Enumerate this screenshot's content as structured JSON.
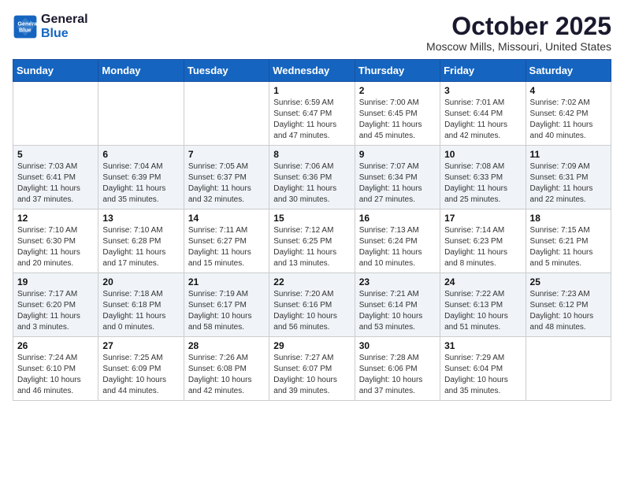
{
  "header": {
    "logo_line1": "General",
    "logo_line2": "Blue",
    "title": "October 2025",
    "subtitle": "Moscow Mills, Missouri, United States"
  },
  "weekdays": [
    "Sunday",
    "Monday",
    "Tuesday",
    "Wednesday",
    "Thursday",
    "Friday",
    "Saturday"
  ],
  "weeks": [
    {
      "shaded": false,
      "days": [
        {
          "date": "",
          "info": ""
        },
        {
          "date": "",
          "info": ""
        },
        {
          "date": "",
          "info": ""
        },
        {
          "date": "1",
          "info": "Sunrise: 6:59 AM\nSunset: 6:47 PM\nDaylight: 11 hours\nand 47 minutes."
        },
        {
          "date": "2",
          "info": "Sunrise: 7:00 AM\nSunset: 6:45 PM\nDaylight: 11 hours\nand 45 minutes."
        },
        {
          "date": "3",
          "info": "Sunrise: 7:01 AM\nSunset: 6:44 PM\nDaylight: 11 hours\nand 42 minutes."
        },
        {
          "date": "4",
          "info": "Sunrise: 7:02 AM\nSunset: 6:42 PM\nDaylight: 11 hours\nand 40 minutes."
        }
      ]
    },
    {
      "shaded": true,
      "days": [
        {
          "date": "5",
          "info": "Sunrise: 7:03 AM\nSunset: 6:41 PM\nDaylight: 11 hours\nand 37 minutes."
        },
        {
          "date": "6",
          "info": "Sunrise: 7:04 AM\nSunset: 6:39 PM\nDaylight: 11 hours\nand 35 minutes."
        },
        {
          "date": "7",
          "info": "Sunrise: 7:05 AM\nSunset: 6:37 PM\nDaylight: 11 hours\nand 32 minutes."
        },
        {
          "date": "8",
          "info": "Sunrise: 7:06 AM\nSunset: 6:36 PM\nDaylight: 11 hours\nand 30 minutes."
        },
        {
          "date": "9",
          "info": "Sunrise: 7:07 AM\nSunset: 6:34 PM\nDaylight: 11 hours\nand 27 minutes."
        },
        {
          "date": "10",
          "info": "Sunrise: 7:08 AM\nSunset: 6:33 PM\nDaylight: 11 hours\nand 25 minutes."
        },
        {
          "date": "11",
          "info": "Sunrise: 7:09 AM\nSunset: 6:31 PM\nDaylight: 11 hours\nand 22 minutes."
        }
      ]
    },
    {
      "shaded": false,
      "days": [
        {
          "date": "12",
          "info": "Sunrise: 7:10 AM\nSunset: 6:30 PM\nDaylight: 11 hours\nand 20 minutes."
        },
        {
          "date": "13",
          "info": "Sunrise: 7:10 AM\nSunset: 6:28 PM\nDaylight: 11 hours\nand 17 minutes."
        },
        {
          "date": "14",
          "info": "Sunrise: 7:11 AM\nSunset: 6:27 PM\nDaylight: 11 hours\nand 15 minutes."
        },
        {
          "date": "15",
          "info": "Sunrise: 7:12 AM\nSunset: 6:25 PM\nDaylight: 11 hours\nand 13 minutes."
        },
        {
          "date": "16",
          "info": "Sunrise: 7:13 AM\nSunset: 6:24 PM\nDaylight: 11 hours\nand 10 minutes."
        },
        {
          "date": "17",
          "info": "Sunrise: 7:14 AM\nSunset: 6:23 PM\nDaylight: 11 hours\nand 8 minutes."
        },
        {
          "date": "18",
          "info": "Sunrise: 7:15 AM\nSunset: 6:21 PM\nDaylight: 11 hours\nand 5 minutes."
        }
      ]
    },
    {
      "shaded": true,
      "days": [
        {
          "date": "19",
          "info": "Sunrise: 7:17 AM\nSunset: 6:20 PM\nDaylight: 11 hours\nand 3 minutes."
        },
        {
          "date": "20",
          "info": "Sunrise: 7:18 AM\nSunset: 6:18 PM\nDaylight: 11 hours\nand 0 minutes."
        },
        {
          "date": "21",
          "info": "Sunrise: 7:19 AM\nSunset: 6:17 PM\nDaylight: 10 hours\nand 58 minutes."
        },
        {
          "date": "22",
          "info": "Sunrise: 7:20 AM\nSunset: 6:16 PM\nDaylight: 10 hours\nand 56 minutes."
        },
        {
          "date": "23",
          "info": "Sunrise: 7:21 AM\nSunset: 6:14 PM\nDaylight: 10 hours\nand 53 minutes."
        },
        {
          "date": "24",
          "info": "Sunrise: 7:22 AM\nSunset: 6:13 PM\nDaylight: 10 hours\nand 51 minutes."
        },
        {
          "date": "25",
          "info": "Sunrise: 7:23 AM\nSunset: 6:12 PM\nDaylight: 10 hours\nand 48 minutes."
        }
      ]
    },
    {
      "shaded": false,
      "days": [
        {
          "date": "26",
          "info": "Sunrise: 7:24 AM\nSunset: 6:10 PM\nDaylight: 10 hours\nand 46 minutes."
        },
        {
          "date": "27",
          "info": "Sunrise: 7:25 AM\nSunset: 6:09 PM\nDaylight: 10 hours\nand 44 minutes."
        },
        {
          "date": "28",
          "info": "Sunrise: 7:26 AM\nSunset: 6:08 PM\nDaylight: 10 hours\nand 42 minutes."
        },
        {
          "date": "29",
          "info": "Sunrise: 7:27 AM\nSunset: 6:07 PM\nDaylight: 10 hours\nand 39 minutes."
        },
        {
          "date": "30",
          "info": "Sunrise: 7:28 AM\nSunset: 6:06 PM\nDaylight: 10 hours\nand 37 minutes."
        },
        {
          "date": "31",
          "info": "Sunrise: 7:29 AM\nSunset: 6:04 PM\nDaylight: 10 hours\nand 35 minutes."
        },
        {
          "date": "",
          "info": ""
        }
      ]
    }
  ]
}
